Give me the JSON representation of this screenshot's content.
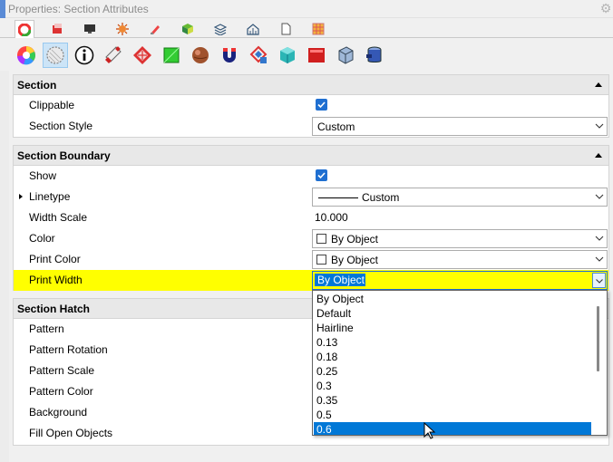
{
  "window": {
    "title": "Properties: Section Attributes"
  },
  "colors": {
    "highlight": "#ffff00",
    "selection": "#0078d7",
    "checkbox": "#1f6fd1"
  },
  "tabs": [
    {
      "name": "tab-color-wheel-icon",
      "active": true
    },
    {
      "name": "tab-layers-icon",
      "active": false
    },
    {
      "name": "tab-display-icon",
      "active": false
    },
    {
      "name": "tab-light-icon",
      "active": false
    },
    {
      "name": "tab-paint-bucket-icon",
      "active": false
    },
    {
      "name": "tab-material-icon",
      "active": false
    },
    {
      "name": "tab-layer-stack-icon",
      "active": false
    },
    {
      "name": "tab-house-icon",
      "active": false
    },
    {
      "name": "tab-page-icon",
      "active": false
    },
    {
      "name": "tab-grid-icon",
      "active": false
    }
  ],
  "toolbar_icons": [
    "color-wheel-icon",
    "section-hatch-icon",
    "info-icon",
    "bottle-icon",
    "texture-icon",
    "green-square-icon",
    "ball-icon",
    "magnet-icon",
    "decal-icon",
    "cube-icon",
    "red-box-icon",
    "frame-icon",
    "cylinder-icon"
  ],
  "section": {
    "title": "Section",
    "rows": {
      "clippable": {
        "label": "Clippable",
        "checked": true
      },
      "section_style": {
        "label": "Section Style",
        "value": "Custom"
      }
    }
  },
  "boundary": {
    "title": "Section Boundary",
    "rows": {
      "show": {
        "label": "Show",
        "checked": true
      },
      "linetype": {
        "label": "Linetype",
        "value": "Custom"
      },
      "width_scale": {
        "label": "Width Scale",
        "value": "10.000"
      },
      "color": {
        "label": "Color",
        "value": "By Object"
      },
      "print_color": {
        "label": "Print Color",
        "value": "By Object"
      },
      "print_width": {
        "label": "Print Width",
        "value": "By Object"
      }
    }
  },
  "hatch": {
    "title": "Section Hatch",
    "rows": {
      "pattern": {
        "label": "Pattern"
      },
      "pattern_rotation": {
        "label": "Pattern Rotation"
      },
      "pattern_scale": {
        "label": "Pattern Scale"
      },
      "pattern_color": {
        "label": "Pattern Color"
      },
      "background": {
        "label": "Background"
      },
      "fill_open_objects": {
        "label": "Fill Open Objects"
      }
    }
  },
  "dropdown": {
    "options": [
      "By Object",
      "Default",
      "Hairline",
      "0.13",
      "0.18",
      "0.25",
      "0.3",
      "0.35",
      "0.5",
      "0.6"
    ],
    "selected_index": 9
  }
}
